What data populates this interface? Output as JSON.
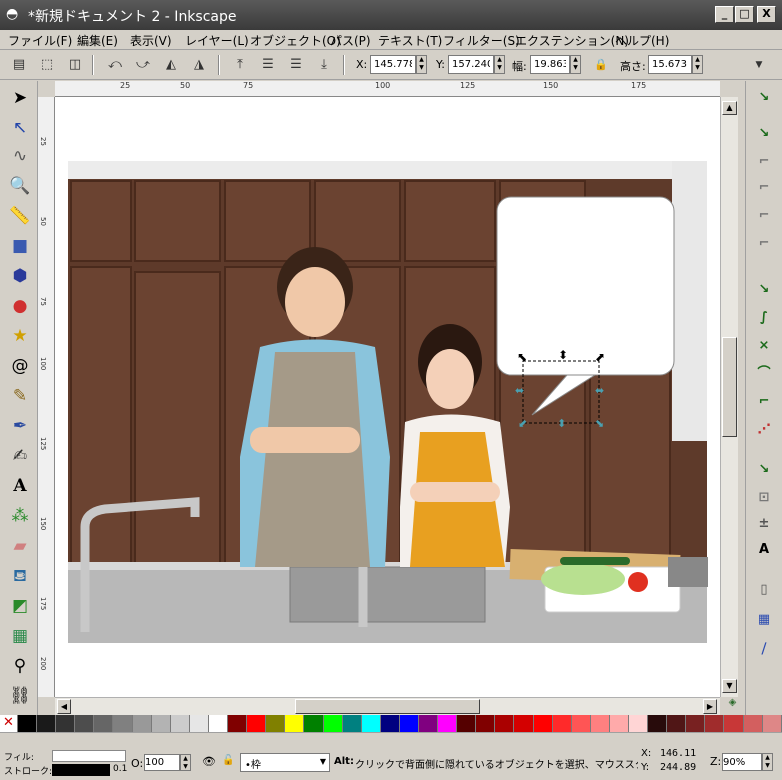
{
  "window": {
    "title": "*新規ドキュメント 2 - Inkscape",
    "min": "_",
    "max": "□",
    "close": "X"
  },
  "menu": [
    "ファイル(F)",
    "編集(E)",
    "表示(V)",
    "レイヤー(L)",
    "オブジェクト(O)",
    "パス(P)",
    "テキスト(T)",
    "フィルター(S)",
    "エクステンション(N)",
    "ヘルプ(H)"
  ],
  "controls": {
    "x_label": "X:",
    "x_value": "145.778",
    "y_label": "Y:",
    "y_value": "157.240",
    "w_label": "幅:",
    "w_value": "19.863",
    "h_label": "高さ:",
    "h_value": "15.673"
  },
  "ruler": {
    "h": [
      "25",
      "50",
      "75",
      "100",
      "125",
      "150",
      "175"
    ],
    "v": [
      "25",
      "50",
      "75",
      "100",
      "125",
      "150",
      "175",
      "200"
    ]
  },
  "status": {
    "fill_label": "フィル:",
    "stroke_label": "ストローク:",
    "stroke_width": "0.1",
    "opacity_label": "O:",
    "opacity_value": "100",
    "layer_value": "•枠",
    "message_key": "Alt:",
    "message": "クリックで背面側に隠れているオブジェクトを選択、マウススク",
    "x_label": "X:",
    "x_coord": "146.11",
    "y_label": "Y:",
    "y_coord": "244.89",
    "zoom_label": "Z:",
    "zoom_value": "90%"
  },
  "palette_colors": [
    "#000000",
    "#1a1a1a",
    "#333333",
    "#4d4d4d",
    "#666666",
    "#808080",
    "#999999",
    "#b3b3b3",
    "#cccccc",
    "#e6e6e6",
    "#ffffff",
    "#800000",
    "#ff0000",
    "#808000",
    "#ffff00",
    "#008000",
    "#00ff00",
    "#008080",
    "#00ffff",
    "#000080",
    "#0000ff",
    "#800080",
    "#ff00ff",
    "#550000",
    "#800000",
    "#aa0000",
    "#d40000",
    "#ff0000",
    "#ff2a2a",
    "#ff5555",
    "#ff8080",
    "#ffaaaa",
    "#ffd5d5",
    "#280b0b",
    "#501616",
    "#782121",
    "#a02c2c",
    "#c83737",
    "#d35f5f",
    "#de8787"
  ]
}
